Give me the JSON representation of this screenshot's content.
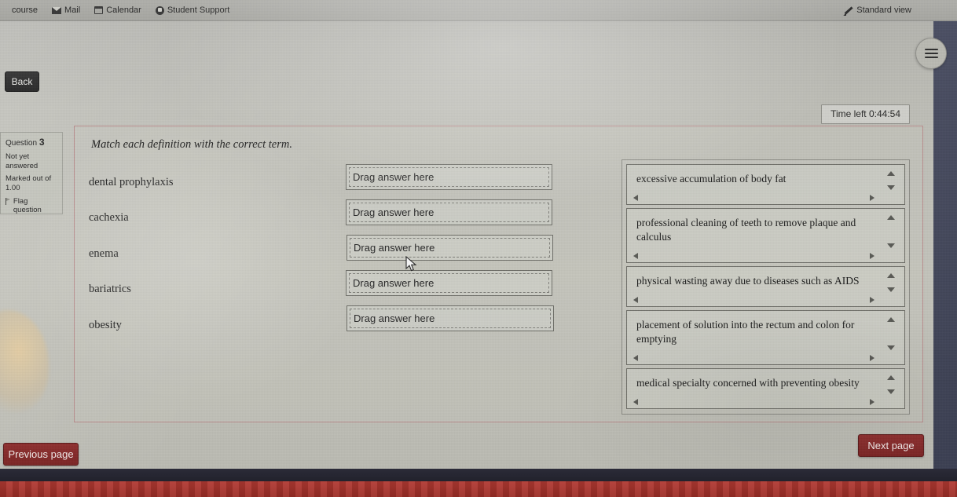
{
  "topnav": {
    "items": [
      {
        "label": "course",
        "icon": ""
      },
      {
        "label": "Mail",
        "icon": "mail-icon"
      },
      {
        "label": "Calendar",
        "icon": "calendar-icon"
      },
      {
        "label": "Student Support",
        "icon": "student-support-icon"
      }
    ],
    "view_mode": "Standard view",
    "view_mode_icon": "pencil-icon",
    "drawer_icon": "hamburger-icon"
  },
  "back_button": "Back",
  "timer": {
    "label": "Time left 0:44:54"
  },
  "question": {
    "number_label": "Question",
    "number": "3",
    "state": "Not yet answered",
    "marks": "Marked out of 1.00",
    "flag_label": "Flag question",
    "flag_icon": "flag-icon",
    "prompt": "Match each definition with the correct term.",
    "terms": [
      "dental prophylaxis",
      "cachexia",
      "enema",
      "bariatrics",
      "obesity"
    ],
    "dropzone_placeholder": "Drag answer here",
    "dropzones": [
      "Drag answer here",
      "Drag answer here",
      "Drag answer here",
      "Drag answer here",
      "Drag answer here"
    ],
    "answers": [
      "excessive accumulation of body fat",
      "professional cleaning of teeth to remove plaque and calculus",
      "physical wasting away due to diseases such as AIDS",
      "placement of solution into the rectum and colon for emptying",
      "medical specialty concerned with preventing obesity"
    ]
  },
  "navigation": {
    "previous_page": "Previous page",
    "next_page": "Next page"
  },
  "colors": {
    "page_button": "#8e3030",
    "question_border": "#b98e8e",
    "bezel_red": "#b23a33",
    "drawer_strip": "#4b4f63"
  }
}
